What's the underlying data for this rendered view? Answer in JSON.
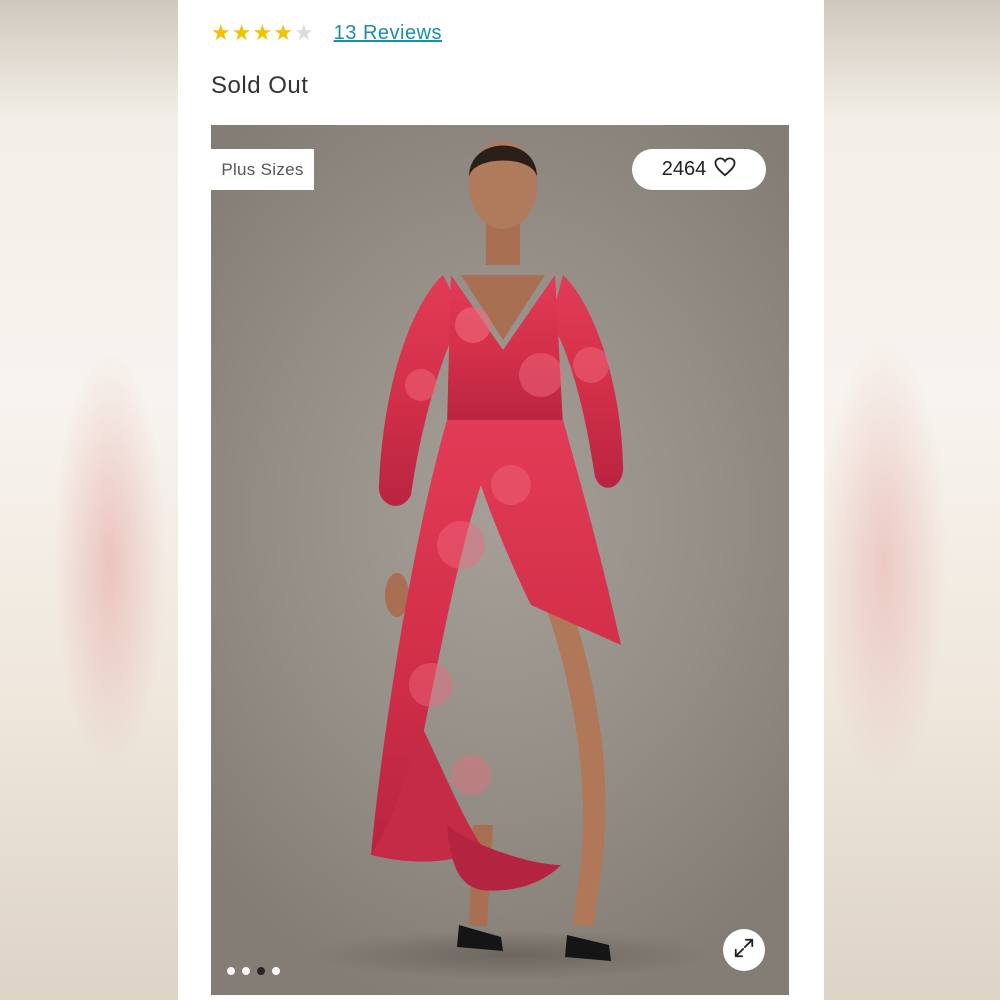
{
  "product": {
    "rating": 4,
    "rating_max": 5,
    "reviews_label": "13 Reviews",
    "status": "Sold Out"
  },
  "gallery": {
    "badge": "Plus Sizes",
    "likes": "2464",
    "dots_total": 4,
    "dots_active_index": 2
  },
  "icons": {
    "like": "heart-icon",
    "expand": "expand-icon",
    "rating": "star-icon"
  },
  "colors": {
    "star": "#f2c200",
    "link": "#1a8fa3",
    "dress": "#d8324a"
  }
}
